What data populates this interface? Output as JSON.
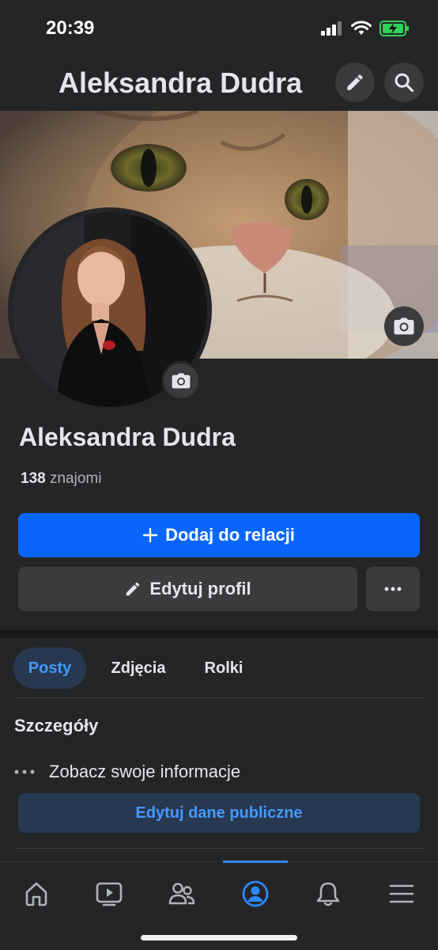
{
  "status_bar": {
    "time": "20:39"
  },
  "header": {
    "title": "Aleksandra Dudra"
  },
  "profile": {
    "name": "Aleksandra Dudra",
    "friends_count": "138",
    "friends_label": "znajomi"
  },
  "actions": {
    "add_story_label": "Dodaj do relacji",
    "edit_profile_label": "Edytuj profil"
  },
  "tabs": [
    {
      "label": "Posty",
      "active": true
    },
    {
      "label": "Zdjęcia",
      "active": false
    },
    {
      "label": "Rolki",
      "active": false
    }
  ],
  "details": {
    "title": "Szczegóły",
    "see_info_label": "Zobacz swoje informacje",
    "edit_public_label": "Edytuj dane publiczne"
  },
  "bottom_nav": {
    "items": [
      "home-icon",
      "video-icon",
      "friends-icon",
      "profile-icon",
      "bell-icon",
      "menu-icon"
    ],
    "active": "profile-icon"
  },
  "colors": {
    "primary": "#0866ff",
    "accent_text": "#4599ff",
    "background": "#242526",
    "surface": "#3a3b3c"
  }
}
